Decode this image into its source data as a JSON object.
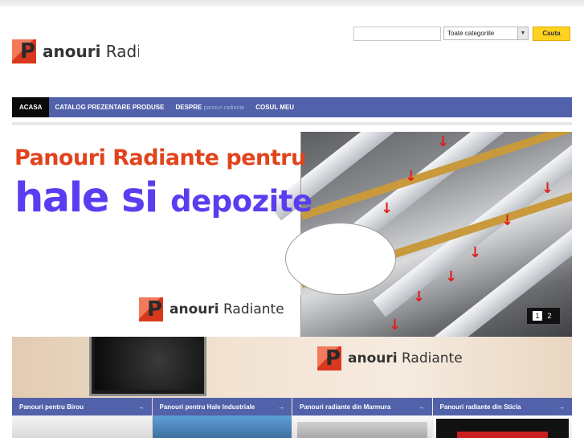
{
  "header": {
    "logo_letter": "P",
    "logo_bold": "anouri",
    "logo_rest": "Radiante",
    "search_placeholder": "",
    "category_select": "Toate categoriile",
    "search_button": "Cauta"
  },
  "nav": {
    "items": [
      {
        "label": "ACASA"
      },
      {
        "label": "CATALOG PREZENTARE PRODUSE"
      },
      {
        "label": "DESPRE",
        "sub": "panouri radiante"
      },
      {
        "label": "COSUL MEU"
      }
    ]
  },
  "banner": {
    "line1": "Panouri Radiante pentru",
    "line2_a": "hale si",
    "line2_b": "depozite",
    "logo_letter": "P",
    "logo_bold": "anouri",
    "logo_rest": "Radiante",
    "pager": [
      "1",
      "2"
    ],
    "pager_active": 0
  },
  "promo": {
    "logo_letter": "P",
    "logo_bold": "anouri",
    "logo_rest": "Radiante",
    "categories": [
      {
        "label": "Panouri pentru Birou",
        "arrow": "→"
      },
      {
        "label": "Panouri pentru Hale Industriale",
        "arrow": "→"
      },
      {
        "label": "Panouri radiante din Marmura",
        "arrow": "→"
      },
      {
        "label": "Panouri radiante din Sticla",
        "arrow": "→"
      }
    ]
  },
  "colors": {
    "nav_bg": "#5161aa",
    "accent_orange": "#e0441c",
    "accent_purple": "#5a3df0",
    "button_yellow": "#ffd21f"
  }
}
